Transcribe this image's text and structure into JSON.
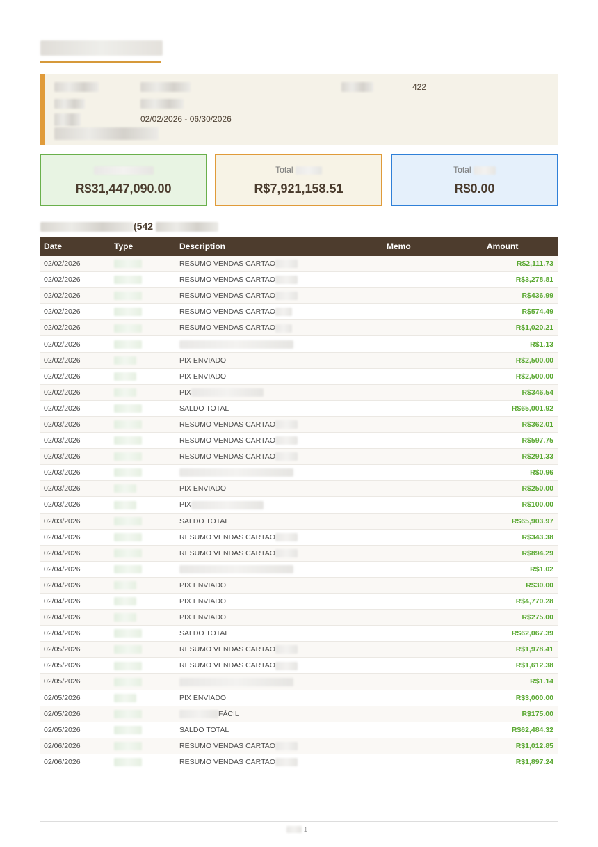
{
  "info": {
    "account_number": "422",
    "period": "02/02/2026 - 06/30/2026"
  },
  "cards": [
    {
      "label": "",
      "value": "R$31,447,090.00",
      "color": "#6ab04c"
    },
    {
      "label": "Total",
      "value": "R$7,921,158.51",
      "color": "#e09b3a"
    },
    {
      "label": "Total",
      "value": "R$0.00",
      "color": "#2f80d8"
    }
  ],
  "section": {
    "count": "(542"
  },
  "table": {
    "headers": {
      "date": "Date",
      "type": "Type",
      "description": "Description",
      "memo": "Memo",
      "amount": "Amount"
    },
    "rows": [
      {
        "date": "02/02/2026",
        "description": "RESUMO VENDAS CARTAO",
        "amount": "R$2,111.73",
        "blur": "mid"
      },
      {
        "date": "02/02/2026",
        "description": "RESUMO VENDAS CARTAO",
        "amount": "R$3,278.81",
        "blur": "mid"
      },
      {
        "date": "02/02/2026",
        "description": "RESUMO VENDAS CARTAO",
        "amount": "R$436.99",
        "blur": "mid"
      },
      {
        "date": "02/02/2026",
        "description": "RESUMO VENDAS CARTAO",
        "amount": "R$574.49",
        "blur": "short"
      },
      {
        "date": "02/02/2026",
        "description": "RESUMO VENDAS CARTAO",
        "amount": "R$1,020.21",
        "blur": "short"
      },
      {
        "date": "02/02/2026",
        "description": "",
        "amount": "R$1.13",
        "blur": "full"
      },
      {
        "date": "02/02/2026",
        "description": "PIX ENVIADO",
        "amount": "R$2,500.00",
        "blur": "none"
      },
      {
        "date": "02/02/2026",
        "description": "PIX ENVIADO",
        "amount": "R$2,500.00",
        "blur": "none"
      },
      {
        "date": "02/02/2026",
        "description": "PIX",
        "amount": "R$346.54",
        "blur": "long"
      },
      {
        "date": "02/02/2026",
        "description": "SALDO TOTAL",
        "amount": "R$65,001.92",
        "blur": "none"
      },
      {
        "date": "02/03/2026",
        "description": "RESUMO VENDAS CARTAO",
        "amount": "R$362.01",
        "blur": "mid"
      },
      {
        "date": "02/03/2026",
        "description": "RESUMO VENDAS CARTAO",
        "amount": "R$597.75",
        "blur": "mid"
      },
      {
        "date": "02/03/2026",
        "description": "RESUMO VENDAS CARTAO",
        "amount": "R$291.33",
        "blur": "mid"
      },
      {
        "date": "02/03/2026",
        "description": "",
        "amount": "R$0.96",
        "blur": "full"
      },
      {
        "date": "02/03/2026",
        "description": "PIX ENVIADO",
        "amount": "R$250.00",
        "blur": "none"
      },
      {
        "date": "02/03/2026",
        "description": "PIX",
        "amount": "R$100.00",
        "blur": "long"
      },
      {
        "date": "02/03/2026",
        "description": "SALDO TOTAL",
        "amount": "R$65,903.97",
        "blur": "none"
      },
      {
        "date": "02/04/2026",
        "description": "RESUMO VENDAS CARTAO",
        "amount": "R$343.38",
        "blur": "mid"
      },
      {
        "date": "02/04/2026",
        "description": "RESUMO VENDAS CARTAO",
        "amount": "R$894.29",
        "blur": "mid"
      },
      {
        "date": "02/04/2026",
        "description": "",
        "amount": "R$1.02",
        "blur": "full"
      },
      {
        "date": "02/04/2026",
        "description": "PIX ENVIADO",
        "amount": "R$30.00",
        "blur": "none"
      },
      {
        "date": "02/04/2026",
        "description": "PIX ENVIADO",
        "amount": "R$4,770.28",
        "blur": "none"
      },
      {
        "date": "02/04/2026",
        "description": "PIX ENVIADO",
        "amount": "R$275.00",
        "blur": "none"
      },
      {
        "date": "02/04/2026",
        "description": "SALDO TOTAL",
        "amount": "R$62,067.39",
        "blur": "none"
      },
      {
        "date": "02/05/2026",
        "description": "RESUMO VENDAS CARTAO",
        "amount": "R$1,978.41",
        "blur": "mid"
      },
      {
        "date": "02/05/2026",
        "description": "RESUMO VENDAS CARTAO",
        "amount": "R$1,612.38",
        "blur": "mid"
      },
      {
        "date": "02/05/2026",
        "description": "",
        "amount": "R$1.14",
        "blur": "full"
      },
      {
        "date": "02/05/2026",
        "description": "PIX ENVIADO",
        "amount": "R$3,000.00",
        "blur": "none"
      },
      {
        "date": "02/05/2026",
        "description": "FÁCIL",
        "amount": "R$175.00",
        "blur": "pre"
      },
      {
        "date": "02/05/2026",
        "description": "SALDO TOTAL",
        "amount": "R$62,484.32",
        "blur": "none"
      },
      {
        "date": "02/06/2026",
        "description": "RESUMO VENDAS CARTAO",
        "amount": "R$1,012.85",
        "blur": "mid"
      },
      {
        "date": "02/06/2026",
        "description": "RESUMO VENDAS CARTAO",
        "amount": "R$1,897.24",
        "blur": "mid"
      }
    ]
  },
  "footer": {
    "page": "1"
  }
}
